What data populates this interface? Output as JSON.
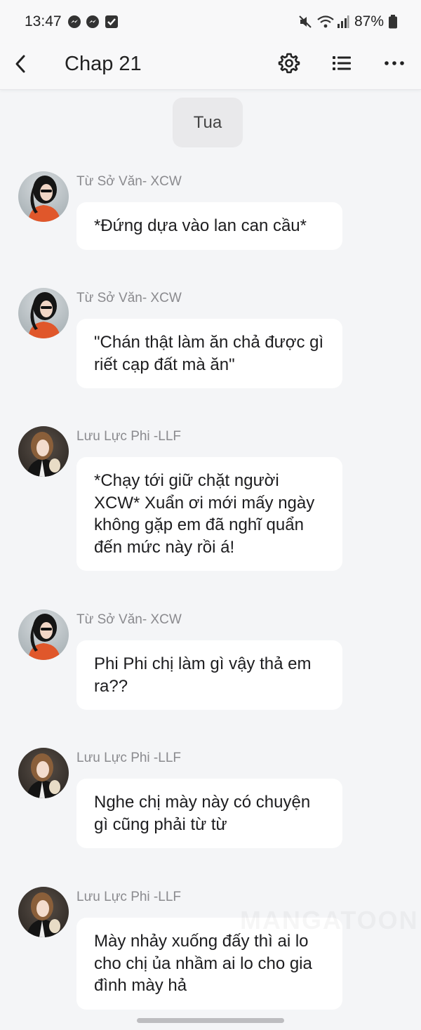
{
  "status_bar": {
    "time": "13:47",
    "battery": "87%",
    "left_icons": [
      "messenger-icon",
      "messenger-icon",
      "checkbox-icon"
    ],
    "right_icons": [
      "mute-icon",
      "wifi-icon",
      "signal-icon",
      "battery-icon"
    ]
  },
  "header": {
    "title": "Chap 21",
    "icons": [
      "back-icon",
      "gear-icon",
      "list-icon",
      "more-icon"
    ]
  },
  "scene": {
    "label": "Tua"
  },
  "messages": [
    {
      "sender": "Từ Sở Văn- XCW",
      "text": "*Đứng dựa vào lan can cầu*",
      "avatar": "xcw"
    },
    {
      "sender": "Từ Sở Văn- XCW",
      "text": "\"Chán thật làm ăn chả được gì riết cạp đất mà ăn\"",
      "avatar": "xcw"
    },
    {
      "sender": "Lưu Lực Phi -LLF",
      "text": "*Chạy tới giữ chặt người XCW* Xuẩn ơi mới mấy ngày không gặp em đã nghĩ quẩn đến mức này rồi á!",
      "avatar": "llf"
    },
    {
      "sender": "Từ Sở Văn- XCW",
      "text": "Phi Phi chị làm gì vậy thả em ra??",
      "avatar": "xcw"
    },
    {
      "sender": "Lưu Lực Phi -LLF",
      "text": "Nghe chị mày này có chuyện gì cũng phải từ từ",
      "avatar": "llf"
    },
    {
      "sender": "Lưu Lực Phi -LLF",
      "text": "Mày nhảy xuống đấy thì ai lo cho chị ủa nhầm ai lo cho gia đình mày hả",
      "avatar": "llf"
    }
  ],
  "watermark": "MANGATOON"
}
